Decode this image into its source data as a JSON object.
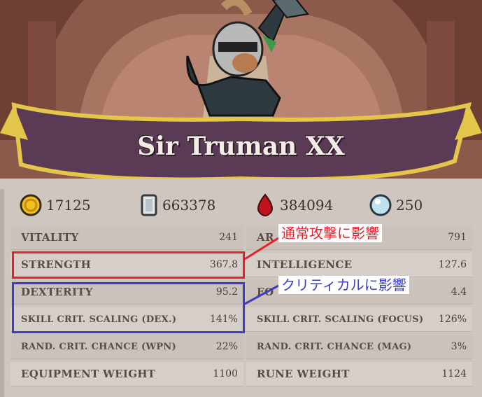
{
  "character": {
    "name": "Sir Truman XX"
  },
  "resources": [
    {
      "icon": "gold-coin-icon",
      "value": "17125"
    },
    {
      "icon": "crystal-icon",
      "value": "663378"
    },
    {
      "icon": "blood-drop-icon",
      "value": "384094"
    },
    {
      "icon": "orb-icon",
      "value": "250"
    }
  ],
  "stats": {
    "left": [
      {
        "label": "VITALITY",
        "value": "241"
      },
      {
        "label": "STRENGTH",
        "value": "367.8"
      },
      {
        "label": "DEXTERITY",
        "value": "95.2"
      },
      {
        "label": "SKILL CRIT. SCALING (DEX.)",
        "value": "141%"
      },
      {
        "label": "RAND. CRIT. CHANCE (WPN)",
        "value": "22%"
      },
      {
        "label": "EQUIPMENT WEIGHT",
        "value": "1100"
      }
    ],
    "right": [
      {
        "label": "AR",
        "value": "791"
      },
      {
        "label": "INTELLIGENCE",
        "value": "127.6"
      },
      {
        "label": "FO",
        "value": "4.4"
      },
      {
        "label": "SKILL CRIT. SCALING (FOCUS)",
        "value": "126%"
      },
      {
        "label": "RAND. CRIT. CHANCE (MAG)",
        "value": "3%"
      },
      {
        "label": "RUNE WEIGHT",
        "value": "1124"
      }
    ]
  },
  "annotations": {
    "red": {
      "text": "通常攻撃に影響",
      "color": "#e8202a"
    },
    "blue": {
      "text": "クリティカルに影響",
      "color": "#3a3fc4"
    }
  }
}
